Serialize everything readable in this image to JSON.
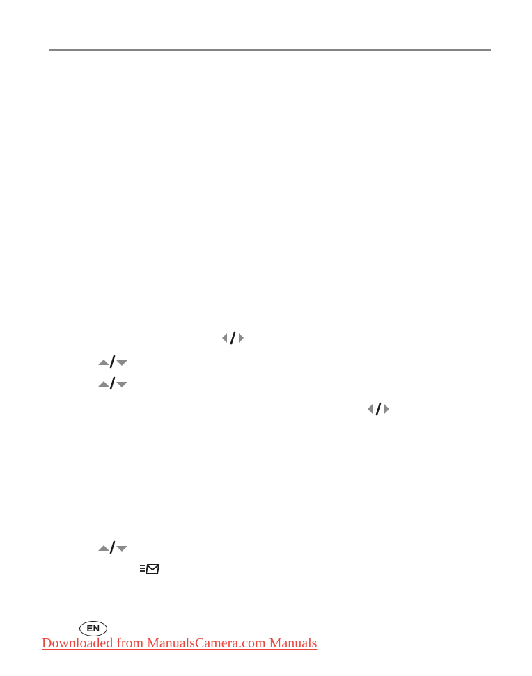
{
  "language_badge": "EN",
  "footer": {
    "download_link": "Downloaded from ManualsCamera.com Manuals"
  },
  "icons": [
    "left-right-arrows-icon",
    "up-down-arrows-icon",
    "up-down-arrows-icon",
    "left-right-arrows-icon",
    "up-down-arrows-icon",
    "share-email-icon"
  ],
  "colors": {
    "rule": "#858585",
    "arrow_gray": "#8a8a8a",
    "glyph_black": "#1a1a1a",
    "link_red": "#e8473f"
  }
}
